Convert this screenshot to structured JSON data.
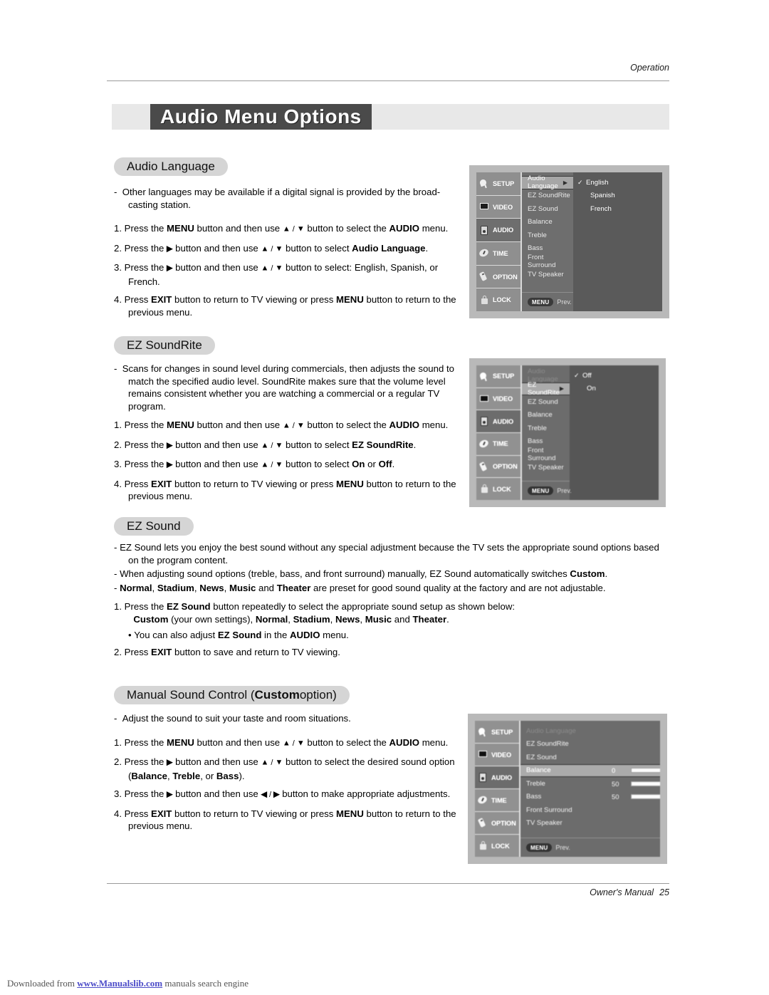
{
  "page": {
    "running_head": "Operation",
    "chapter_title": "Audio Menu Options",
    "footer_label": "Owner's Manual",
    "page_number": "25"
  },
  "watermark": {
    "prefix": "Downloaded from ",
    "link": "www.Manualslib.com",
    "suffix": " manuals search engine"
  },
  "sections": {
    "audio_language": {
      "heading": "Audio Language",
      "dash1": "Other languages may be available if a digital signal is provided by the broad-casting station.",
      "step1_a": "Press the ",
      "step1_menu": "MENU",
      "step1_b": " button and then use ",
      "step1_c": " button to select the ",
      "step1_audio": "AUDIO",
      "step1_d": " menu.",
      "step2_a": "Press the ",
      "step2_b": " button and then use ",
      "step2_c": " button to select ",
      "step2_bold": "Audio Language",
      "step2_d": ".",
      "step3_a": "Press the ",
      "step3_b": " button and then use ",
      "step3_c": " button to select: English, Spanish, or French.",
      "step4_a": "Press ",
      "step4_exit": "EXIT",
      "step4_b": " button to return to TV viewing or press ",
      "step4_menu": "MENU",
      "step4_c": " button to return to the previous menu."
    },
    "ez_soundrite": {
      "heading": "EZ SoundRite",
      "dash1": "Scans for changes in sound level during commercials, then adjusts the sound to match the specified audio level. SoundRite makes sure that the volume level remains consistent whether you are watching a commercial or a regular TV program.",
      "step2_bold": "EZ SoundRite",
      "step3_on": "On",
      "step3_or": " or ",
      "step3_off": "Off"
    },
    "ez_sound": {
      "heading": "EZ Sound",
      "dash1": "EZ Sound lets you enjoy the best sound without any special adjustment because the TV sets the appropriate sound options based on the program content.",
      "dash2_a": "When adjusting sound options (treble, bass, and front surround) manually, EZ Sound automatically switches ",
      "dash2_custom": "Custom",
      "dash2_b": ".",
      "dash3_normal": "Normal",
      "dash3_stadium": "Stadium",
      "dash3_news": "News",
      "dash3_music": "Music",
      "dash3_theater": "Theater",
      "dash3_tail": " are preset for good sound quality at the factory and are not adjustable.",
      "step1_a": "Press the ",
      "step1_ez": "EZ Sound",
      "step1_b": " button repeatedly to select the appropriate sound setup as shown below:",
      "step1_list_custom": "Custom",
      "step1_list_own": " (your own settings), ",
      "bullet_a": "You can also adjust ",
      "bullet_ez": "EZ Sound",
      "bullet_b": " in the ",
      "bullet_audio": "AUDIO",
      "bullet_c": " menu.",
      "step2_a": "Press ",
      "step2_exit": "EXIT",
      "step2_b": " button to save and return to TV viewing."
    },
    "manual_sound": {
      "heading_plain_1": "Manual Sound Control (",
      "heading_bold": "Custom",
      "heading_plain_2": " option)",
      "dash1": "Adjust the sound to suit your taste and room situations.",
      "step2_c": " button to select the desired sound option",
      "step2_balance": "Balance",
      "step2_treble": "Treble",
      "step2_or": ", or ",
      "step2_bass": "Bass",
      "step2_end": ").",
      "step3_a": "Press the ",
      "step3_b": " button and then use ",
      "step3_c": " button to make appropriate adjustments."
    }
  },
  "osd": {
    "icons": [
      {
        "label": "SETUP",
        "icon": "satellite-dish-icon"
      },
      {
        "label": "VIDEO",
        "icon": "tv-screen-icon"
      },
      {
        "label": "AUDIO",
        "icon": "speaker-icon"
      },
      {
        "label": "TIME",
        "icon": "clock-icon"
      },
      {
        "label": "OPTION",
        "icon": "remote-control-icon"
      },
      {
        "label": "LOCK",
        "icon": "padlock-icon"
      }
    ],
    "menu_items": [
      "Audio Language",
      "EZ SoundRite",
      "EZ Sound",
      "Balance",
      "Treble",
      "Bass",
      "Front Surround",
      "TV Speaker"
    ],
    "prev_key": "MENU",
    "prev_label": "Prev.",
    "screen1": {
      "selected": "Audio Language",
      "options": [
        {
          "label": "English",
          "checked": true
        },
        {
          "label": "Spanish",
          "checked": false
        },
        {
          "label": "French",
          "checked": false
        }
      ]
    },
    "screen2": {
      "selected": "EZ SoundRite",
      "options": [
        {
          "label": "Off",
          "checked": true
        },
        {
          "label": "On",
          "checked": false
        }
      ]
    },
    "screen3": {
      "selected": "Balance",
      "values": [
        {
          "label": "Balance",
          "value": "0",
          "fill": 50
        },
        {
          "label": "Treble",
          "value": "50",
          "fill": 50
        },
        {
          "label": "Bass",
          "value": "50",
          "fill": 50
        }
      ]
    }
  }
}
